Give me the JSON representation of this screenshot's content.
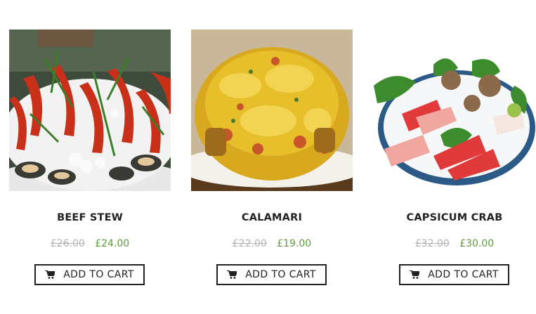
{
  "products": [
    {
      "name": "BEEF STEW",
      "old_price": "£26.00",
      "price": "£24.00",
      "button": "ADD TO CART",
      "image": "crayfish-platter-photo"
    },
    {
      "name": "CALAMARI",
      "old_price": "£22.00",
      "price": "£19.00",
      "button": "ADD TO CART",
      "image": "cheesy-seafood-dish-photo"
    },
    {
      "name": "CAPSICUM CRAB",
      "old_price": "£32.00",
      "price": "£30.00",
      "button": "ADD TO CART",
      "image": "sashimi-platter-photo"
    }
  ],
  "icons": {
    "cart": "shopping-cart-icon"
  },
  "colors": {
    "sale_price": "#5f9e3b",
    "old_price": "#b3b3b3",
    "text": "#222222"
  }
}
